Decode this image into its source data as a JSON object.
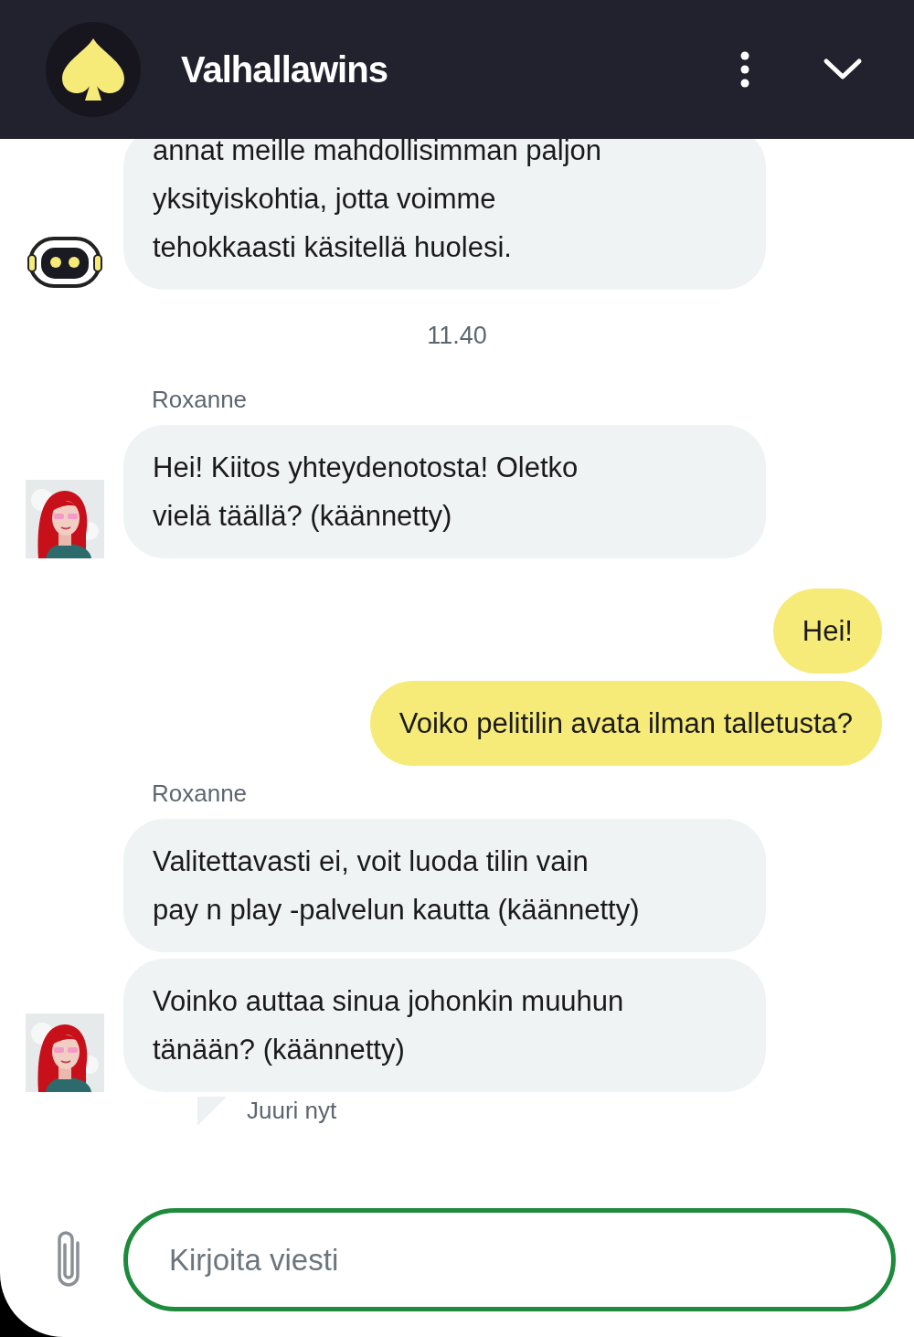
{
  "header": {
    "title": "Valhallawins"
  },
  "feed": [
    {
      "kind": "bot_group",
      "bubbles": [
        "annat meille mahdollisimman paljon\nyksityiskohtia, jotta voimme\ntehokkaasti käsitellä huolesi."
      ]
    },
    {
      "kind": "time",
      "text": "11.40"
    },
    {
      "kind": "agent_group",
      "sender": "Roxanne",
      "bubbles": [
        "Hei! Kiitos yhteydenotosta! Oletko\nvielä täällä? (käännetty)"
      ]
    },
    {
      "kind": "user_group",
      "bubbles": [
        "Hei!",
        "Voiko pelitilin avata ilman talletusta?"
      ]
    },
    {
      "kind": "agent_group",
      "sender": "Roxanne",
      "bubbles": [
        "Valitettavasti ei, voit luoda tilin vain\npay n play -palvelun kautta (käännetty)",
        "Voinko auttaa sinua johonkin muuhun\ntänään? (käännetty)"
      ],
      "status": "Juuri nyt"
    }
  ],
  "composer": {
    "placeholder": "Kirjoita viesti"
  }
}
